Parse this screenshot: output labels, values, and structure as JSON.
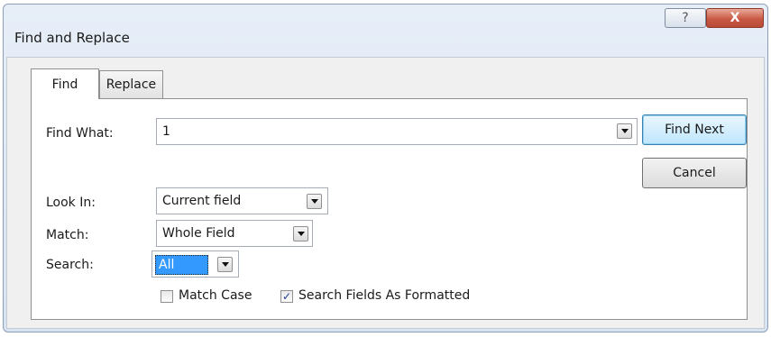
{
  "dialog": {
    "title": "Find and Replace",
    "help_label": "?",
    "close_label": "X"
  },
  "tabs": [
    {
      "label": "Find",
      "active": true
    },
    {
      "label": "Replace",
      "active": false
    }
  ],
  "form": {
    "find_what_label": "Find What:",
    "find_what_value": "1",
    "look_in_label": "Look In:",
    "look_in_value": "Current field",
    "match_label": "Match:",
    "match_value": "Whole Field",
    "search_label": "Search:",
    "search_value": "All",
    "match_case_label": "Match Case",
    "match_case_checked": false,
    "search_formatted_label": "Search Fields As Formatted",
    "search_formatted_checked": true
  },
  "buttons": {
    "find_next_label": "Find Next",
    "cancel_label": "Cancel"
  },
  "icons": {
    "help": "question-mark",
    "close": "x-mark",
    "dropdown": "triangle-down",
    "checked": "check-mark"
  }
}
